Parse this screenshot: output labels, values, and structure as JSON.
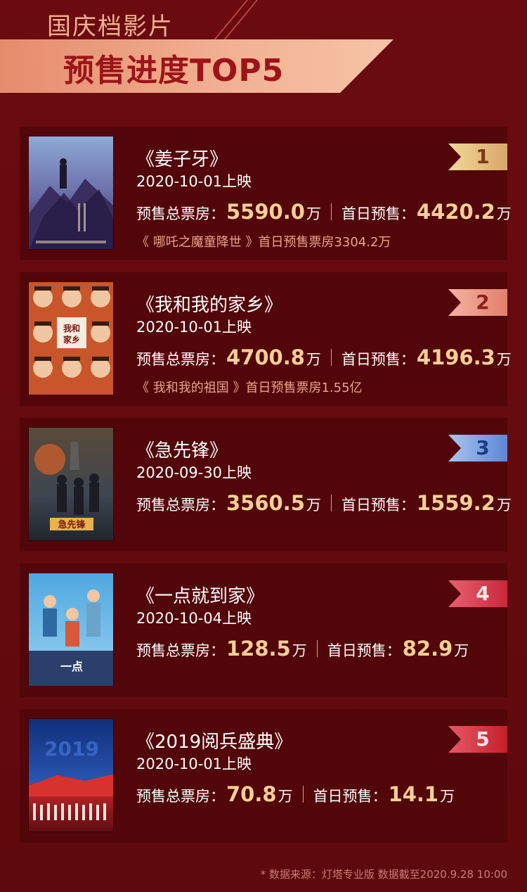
{
  "header": {
    "tag": "国庆档影片",
    "title": "预售进度TOP5"
  },
  "movies": [
    {
      "rank": "1",
      "title": "《姜子牙》",
      "release": "2020-10-01上映",
      "presale_label": "预售总票房",
      "presale_value": "5590.0",
      "presale_unit": "万",
      "firstday_label": "首日预售",
      "firstday_value": "4420.2",
      "firstday_unit": "万",
      "compare": "《 哪吒之魔童降世 》首日预售票房3304.2万"
    },
    {
      "rank": "2",
      "title": "《我和我的家乡》",
      "release": "2020-10-01上映",
      "presale_label": "预售总票房",
      "presale_value": "4700.8",
      "presale_unit": "万",
      "firstday_label": "首日预售",
      "firstday_value": "4196.3",
      "firstday_unit": "万",
      "compare": "《 我和我的祖国 》首日预售票房1.55亿"
    },
    {
      "rank": "3",
      "title": "《急先锋》",
      "release": "2020-09-30上映",
      "presale_label": "预售总票房",
      "presale_value": "3560.5",
      "presale_unit": "万",
      "firstday_label": "首日预售",
      "firstday_value": "1559.2",
      "firstday_unit": "万",
      "compare": ""
    },
    {
      "rank": "4",
      "title": "《一点就到家》",
      "release": "2020-10-04上映",
      "presale_label": "预售总票房",
      "presale_value": "128.5",
      "presale_unit": "万",
      "firstday_label": "首日预售",
      "firstday_value": "82.9",
      "firstday_unit": "万",
      "compare": ""
    },
    {
      "rank": "5",
      "title": "《2019阅兵盛典》",
      "release": "2020-10-01上映",
      "presale_label": "预售总票房",
      "presale_value": "70.8",
      "presale_unit": "万",
      "firstday_label": "首日预售",
      "firstday_value": "14.1",
      "firstday_unit": "万",
      "compare": ""
    }
  ],
  "footnote": "* 数据来源：灯塔专业版 数据截至2020.9.28 10:00",
  "colors": {
    "background": "#640a0e",
    "card": "#520609",
    "value": "#f6cf96",
    "banner": "#f2b294",
    "title_red": "#9c1418"
  },
  "icons": {
    "rank_badge": "ribbon-flag-icon"
  }
}
